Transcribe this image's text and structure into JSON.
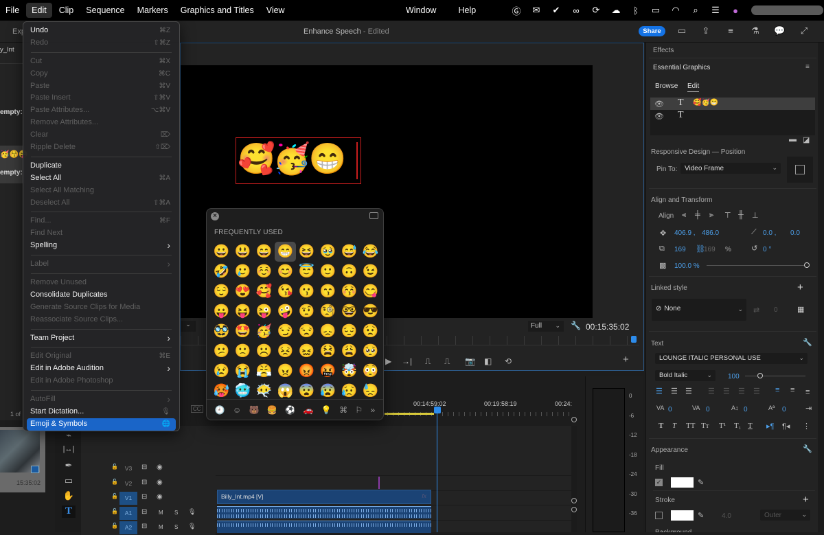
{
  "menubar": {
    "left": [
      "File",
      "Edit",
      "Clip",
      "Sequence",
      "Markers",
      "Graphics and Titles",
      "View"
    ],
    "active": "Edit",
    "mid": [
      "Window",
      "Help"
    ],
    "status_icons": [
      "grammarly-icon",
      "outlook-icon",
      "check-circle-icon",
      "creative-cloud-icon",
      "sync-icon",
      "onedrive-icon",
      "bluetooth-icon",
      "battery-icon",
      "wifi-icon",
      "search-icon",
      "control-center-icon",
      "siri-icon"
    ]
  },
  "toolbar": {
    "left_label": "Exp",
    "title": "Enhance Speech",
    "title_suffix": " - Edited",
    "share_label": "Share"
  },
  "left_strip": {
    "clip_name": "y_Int",
    "empty1": "empty:",
    "empty2": "empty:",
    "page_of": "1 of",
    "thumb_tc": "15:35:02"
  },
  "edit_menu": {
    "items": [
      {
        "label": "Undo",
        "shortcut": "⌘Z",
        "enabled": true
      },
      {
        "label": "Redo",
        "shortcut": "⇧⌘Z",
        "enabled": false
      },
      {
        "sep": true
      },
      {
        "label": "Cut",
        "shortcut": "⌘X",
        "enabled": false
      },
      {
        "label": "Copy",
        "shortcut": "⌘C",
        "enabled": false
      },
      {
        "label": "Paste",
        "shortcut": "⌘V",
        "enabled": false
      },
      {
        "label": "Paste Insert",
        "shortcut": "⇧⌘V",
        "enabled": false
      },
      {
        "label": "Paste Attributes...",
        "shortcut": "⌥⌘V",
        "enabled": false
      },
      {
        "label": "Remove Attributes...",
        "shortcut": "",
        "enabled": false
      },
      {
        "label": "Clear",
        "shortcut": "⌦",
        "enabled": false
      },
      {
        "label": "Ripple Delete",
        "shortcut": "⇧⌦",
        "enabled": false
      },
      {
        "sep": true
      },
      {
        "label": "Duplicate",
        "shortcut": "",
        "enabled": true
      },
      {
        "label": "Select All",
        "shortcut": "⌘A",
        "enabled": true
      },
      {
        "label": "Select All Matching",
        "shortcut": "",
        "enabled": false
      },
      {
        "label": "Deselect All",
        "shortcut": "⇧⌘A",
        "enabled": false
      },
      {
        "sep": true
      },
      {
        "label": "Find...",
        "shortcut": "⌘F",
        "enabled": false
      },
      {
        "label": "Find Next",
        "shortcut": "",
        "enabled": false
      },
      {
        "label": "Spelling",
        "shortcut": "›",
        "enabled": true
      },
      {
        "sep": true
      },
      {
        "label": "Label",
        "shortcut": "›",
        "enabled": false
      },
      {
        "sep": true
      },
      {
        "label": "Remove Unused",
        "shortcut": "",
        "enabled": false
      },
      {
        "label": "Consolidate Duplicates",
        "shortcut": "",
        "enabled": true
      },
      {
        "label": "Generate Source Clips for Media",
        "shortcut": "",
        "enabled": false
      },
      {
        "label": "Reassociate Source Clips...",
        "shortcut": "",
        "enabled": false
      },
      {
        "sep": true
      },
      {
        "label": "Team Project",
        "shortcut": "›",
        "enabled": true
      },
      {
        "sep": true
      },
      {
        "label": "Edit Original",
        "shortcut": "⌘E",
        "enabled": false
      },
      {
        "label": "Edit in Adobe Audition",
        "shortcut": "›",
        "enabled": true
      },
      {
        "label": "Edit in Adobe Photoshop",
        "shortcut": "",
        "enabled": false
      },
      {
        "sep": true
      },
      {
        "label": "AutoFill",
        "shortcut": "›",
        "enabled": false
      },
      {
        "label": "Start Dictation...",
        "shortcut": "🎙",
        "enabled": true
      },
      {
        "label": "Emoji & Symbols",
        "shortcut": "🌐",
        "enabled": true,
        "selected": true
      }
    ]
  },
  "program_monitor": {
    "title_emojis": "🥰🥳😁",
    "fit": "Full",
    "timecode": "00:15:35:02"
  },
  "emoji_picker": {
    "heading": "FREQUENTLY USED",
    "highlighted_index": 3,
    "emojis": [
      "😀",
      "😃",
      "😄",
      "😁",
      "😆",
      "🥹",
      "😅",
      "😂",
      "🤣",
      "🥲",
      "☺️",
      "😊",
      "😇",
      "🙂",
      "🙃",
      "😉",
      "😌",
      "😍",
      "🥰",
      "😘",
      "😗",
      "😙",
      "😚",
      "😋",
      "😛",
      "😝",
      "😜",
      "🤪",
      "🤨",
      "🧐",
      "🤓",
      "😎",
      "🥸",
      "🤩",
      "🥳",
      "😏",
      "😒",
      "😞",
      "😔",
      "😟",
      "😕",
      "🙁",
      "☹️",
      "😣",
      "😖",
      "😫",
      "😩",
      "🥺",
      "😢",
      "😭",
      "😤",
      "😠",
      "😡",
      "🤬",
      "🤯",
      "😳",
      "🥵",
      "🥶",
      "😶‍🌫️",
      "😱",
      "😨",
      "😰",
      "😥",
      "😓"
    ],
    "categories": [
      {
        "name": "recent-icon",
        "glyph": "🕘",
        "active": true
      },
      {
        "name": "smileys-icon",
        "glyph": "☺",
        "active": false
      },
      {
        "name": "animals-icon",
        "glyph": "🐻",
        "active": false
      },
      {
        "name": "food-icon",
        "glyph": "🍔",
        "active": false
      },
      {
        "name": "activity-icon",
        "glyph": "⚽",
        "active": false
      },
      {
        "name": "travel-icon",
        "glyph": "🚗",
        "active": false
      },
      {
        "name": "objects-icon",
        "glyph": "💡",
        "active": false
      },
      {
        "name": "symbols-icon",
        "glyph": "⌘",
        "active": false
      },
      {
        "name": "flags-icon",
        "glyph": "⚐",
        "active": false
      },
      {
        "name": "more-icon",
        "glyph": "»",
        "active": false
      }
    ]
  },
  "right_panel": {
    "effects": "Effects",
    "essential_graphics": "Essential Graphics",
    "tabs": [
      "Browse",
      "Edit"
    ],
    "active_tab": "Edit",
    "layers": [
      {
        "type": "T",
        "name": "🥰🥳😁"
      },
      {
        "type": "T",
        "name": ""
      }
    ],
    "responsive_title": "Responsive Design — Position",
    "pin_to_label": "Pin To:",
    "pin_to_value": "Video Frame",
    "align_transform": "Align and Transform",
    "align_label": "Align",
    "pos_x": "406.9 ,",
    "pos_y": "486.0",
    "anchor_x": "0.0 ,",
    "anchor_y": "0.0",
    "scale": "169",
    "scale_locked": "169",
    "scale_unit": "%",
    "rotation": "0 °",
    "opacity": "100.0 %",
    "opacity_value": 1.0,
    "linked_style": "Linked style",
    "style_value": "None",
    "style_count": "0",
    "text_title": "Text",
    "font": "LOUNGE ITALIC PERSONAL USE",
    "font_style": "Bold Italic",
    "font_size": "100",
    "font_size_fraction": 0.25,
    "tracking": [
      "0",
      "0",
      "0",
      "0"
    ],
    "appearance": "Appearance",
    "fill": "Fill",
    "fill_checked": true,
    "fill_color": "#ffffff",
    "stroke": "Stroke",
    "stroke_checked": false,
    "stroke_color": "#ffffff",
    "stroke_width": "4.0",
    "stroke_type": "Outer",
    "background": "Background"
  },
  "timeline": {
    "timecodes": [
      "00:14:59:02",
      "00:19:58:19",
      "00:24:"
    ],
    "tracks": [
      {
        "label": "V3",
        "active": false,
        "type": "video"
      },
      {
        "label": "V2",
        "active": false,
        "type": "video"
      },
      {
        "label": "V1",
        "active": true,
        "type": "video"
      },
      {
        "label": "A1",
        "active": true,
        "type": "audio"
      },
      {
        "label": "A2",
        "active": true,
        "type": "audio"
      }
    ],
    "clip_name": "Billy_Int.mp4 [V]",
    "clip_fx": "fx",
    "meter_scale": [
      "0",
      "-6",
      "-12",
      "-18",
      "-24",
      "-30",
      "-36"
    ]
  },
  "colors": {
    "accent": "#1473e6",
    "selection": "#1a65c8",
    "clip": "#1b4375",
    "text_box": "#c81e1e"
  }
}
